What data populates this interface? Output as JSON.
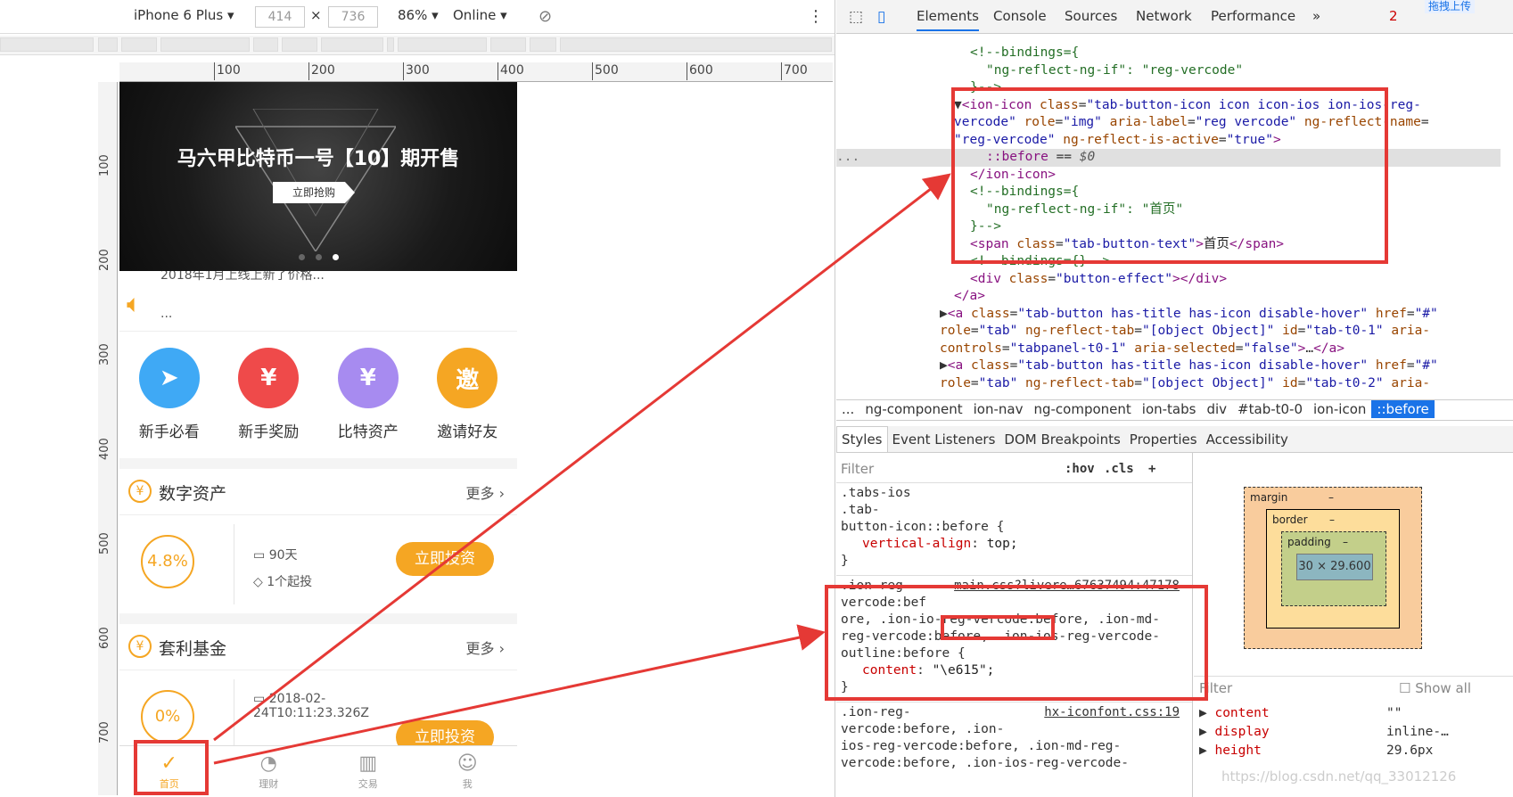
{
  "device_toolbar": {
    "device": "iPhone 6 Plus",
    "width": "414",
    "height": "736",
    "zoom": "86%",
    "network": "Online",
    "times": "×"
  },
  "rulers": {
    "h": [
      "100",
      "200",
      "300",
      "400",
      "500",
      "600",
      "700"
    ],
    "v": [
      "100",
      "200",
      "300",
      "400",
      "500",
      "600",
      "700"
    ]
  },
  "phone": {
    "banner_title": "马六甲比特币一号【10】期开售",
    "banner_button": "立即抢购",
    "notice_line1": "2018年1月上线上新了价格...",
    "notice_line2": "...",
    "entries": [
      {
        "label": "新手必看",
        "icon": "paper-plane-icon",
        "color": "#3fa9f5",
        "glyph": "➤"
      },
      {
        "label": "新手奖励",
        "icon": "money-bag-icon",
        "color": "#ef4a4a",
        "glyph": "¥"
      },
      {
        "label": "比特资产",
        "icon": "shield-icon",
        "color": "#a78bf0",
        "glyph": "¥"
      },
      {
        "label": "邀请好友",
        "icon": "users-icon",
        "color": "#f5a623",
        "glyph": "邀"
      }
    ],
    "section1": {
      "title": "数字资产",
      "more": "更多",
      "yen": "¥"
    },
    "product1": {
      "rate": "4.8%",
      "term": "90天",
      "min": "1个起投",
      "buy": "立即投资"
    },
    "section2": {
      "title": "套利基金",
      "more": "更多",
      "yen": "¥"
    },
    "product2": {
      "rate": "0%",
      "date": "2018-02-24T10:11:23.326Z",
      "buy": "立即投资"
    },
    "tabs": [
      {
        "label": "首页",
        "icon": "shield-check-icon",
        "glyph": "✓"
      },
      {
        "label": "理财",
        "icon": "chart-circle-icon",
        "glyph": "◔"
      },
      {
        "label": "交易",
        "icon": "bars-icon",
        "glyph": "▥"
      },
      {
        "label": "我",
        "icon": "user-icon",
        "glyph": "☺"
      }
    ]
  },
  "devtools": {
    "tabs": [
      "Elements",
      "Console",
      "Sources",
      "Network",
      "Performance"
    ],
    "more": "»",
    "badge": "2",
    "breadcrumbs": [
      "...",
      "ng-component",
      "ion-nav",
      "ng-component",
      "ion-tabs",
      "div",
      "#tab-t0-0",
      "ion-icon",
      "::before"
    ],
    "style_tabs": [
      "Styles",
      "Event Listeners",
      "DOM Breakpoints",
      "Properties",
      "Accessibility"
    ],
    "filter": "Filter",
    "hov": ":hov",
    "cls": ".cls",
    "plus": "+",
    "rule1": {
      "selector1": ".tabs-ios",
      ".src": "main.css?livere…67637494:26234",
      "selector2": ".tab-",
      "selector3": "button-icon::before {",
      "prop": "vertical-align",
      "val": "top;",
      "close": "}"
    },
    "rule2": {
      "src": "main.css?livere…67637494:47178",
      "l1": ".ion-reg-",
      "l2": "vercode:bef",
      "l3a": "ore, .ion-io",
      "l3b": "-reg-vercode:",
      "l3c": "before, .ion-md-",
      "l4": "reg-vercode:before, .ion-ios-reg-vercode-",
      "l5": "outline:before {",
      "prop": "content",
      "val": "\"\\e615\";",
      "close": "}"
    },
    "rule3": {
      "src": "hx-iconfont.css:19",
      "l1": ".ion-reg-",
      "l2": "vercode:before, .ion-",
      "l3": "ios-reg-vercode:before, .ion-md-reg-",
      "l4": "vercode:before, .ion-ios-reg-vercode-"
    },
    "boxmodel": {
      "margin": "margin",
      "border": "border",
      "padding": "padding",
      "content": "30 × 29.600",
      "dash": "–"
    },
    "computed_filter": "Filter",
    "show_all": "Show all",
    "computed": [
      {
        "name": "content",
        "value": "\"\""
      },
      {
        "name": "display",
        "value": "inline-…"
      },
      {
        "name": "height",
        "value": "29.6px"
      }
    ],
    "watermark": "https://blog.csdn.net/qq_33012126",
    "upload": "拖拽上传"
  }
}
